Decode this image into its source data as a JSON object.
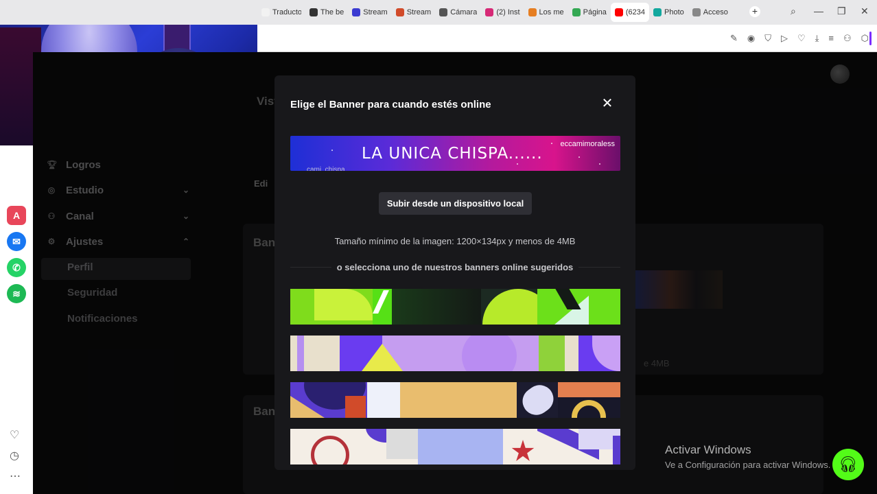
{
  "browser": {
    "tabs": [
      {
        "label": "Traducto",
        "color": "#f2f2f2"
      },
      {
        "label": "The be",
        "color": "#333333"
      },
      {
        "label": "Stream",
        "color": "#3b3bd1"
      },
      {
        "label": "Stream",
        "color": "#d14b2a"
      },
      {
        "label": "Cámara",
        "color": "#555555"
      },
      {
        "label": "(2) Inst",
        "color": "#d62976"
      },
      {
        "label": "Los me",
        "color": "#e67e22"
      },
      {
        "label": "Página",
        "color": "#34a853"
      },
      {
        "label": "(6234",
        "color": "#ff0000"
      },
      {
        "label": "Photo",
        "color": "#13a89e"
      },
      {
        "label": "Acceso",
        "color": "#888888"
      }
    ],
    "active_tab_index": 8,
    "new_tab_label": "+",
    "accent_color": "#7b2cff"
  },
  "sidebar": {
    "items": [
      {
        "label": "Logros",
        "icon": "trophy-icon"
      },
      {
        "label": "Estudio",
        "icon": "studio-icon",
        "chevron": "down"
      },
      {
        "label": "Canal",
        "icon": "channel-icon",
        "chevron": "down"
      },
      {
        "label": "Ajustes",
        "icon": "gear-icon",
        "chevron": "up"
      }
    ],
    "subitems": [
      {
        "label": "Perfil",
        "active": true
      },
      {
        "label": "Seguridad",
        "active": false
      },
      {
        "label": "Notificaciones",
        "active": false
      }
    ]
  },
  "background": {
    "heading_vis": "Vist",
    "heading_ban1": "Ban",
    "heading_ban2": "Ban",
    "edit_label": "Edi",
    "size_tail": "e 4MB"
  },
  "modal": {
    "title": "Elige el Banner para cuando estés online",
    "close_label": "✕",
    "current_banner_text": "LA UNICA CHISPA......",
    "current_banner_handle": "eccamimoraless",
    "current_banner_subtext": "cami_chispa",
    "upload_label": "Subir desde un dispositivo local",
    "size_note": "Tamaño mínimo de la imagen: 1200×134px y menos de 4MB",
    "or_label": "o selecciona uno de nuestros banners online sugeridos",
    "suggested": [
      "green",
      "purple",
      "orange",
      "cream"
    ]
  },
  "watermark": {
    "title": "Activar Windows",
    "subtitle": "Ve a Configuración para activar Windows."
  },
  "colors": {
    "kick_green": "#53fc18",
    "modal_bg": "#18181b",
    "page_bg": "#0b0b0c"
  }
}
